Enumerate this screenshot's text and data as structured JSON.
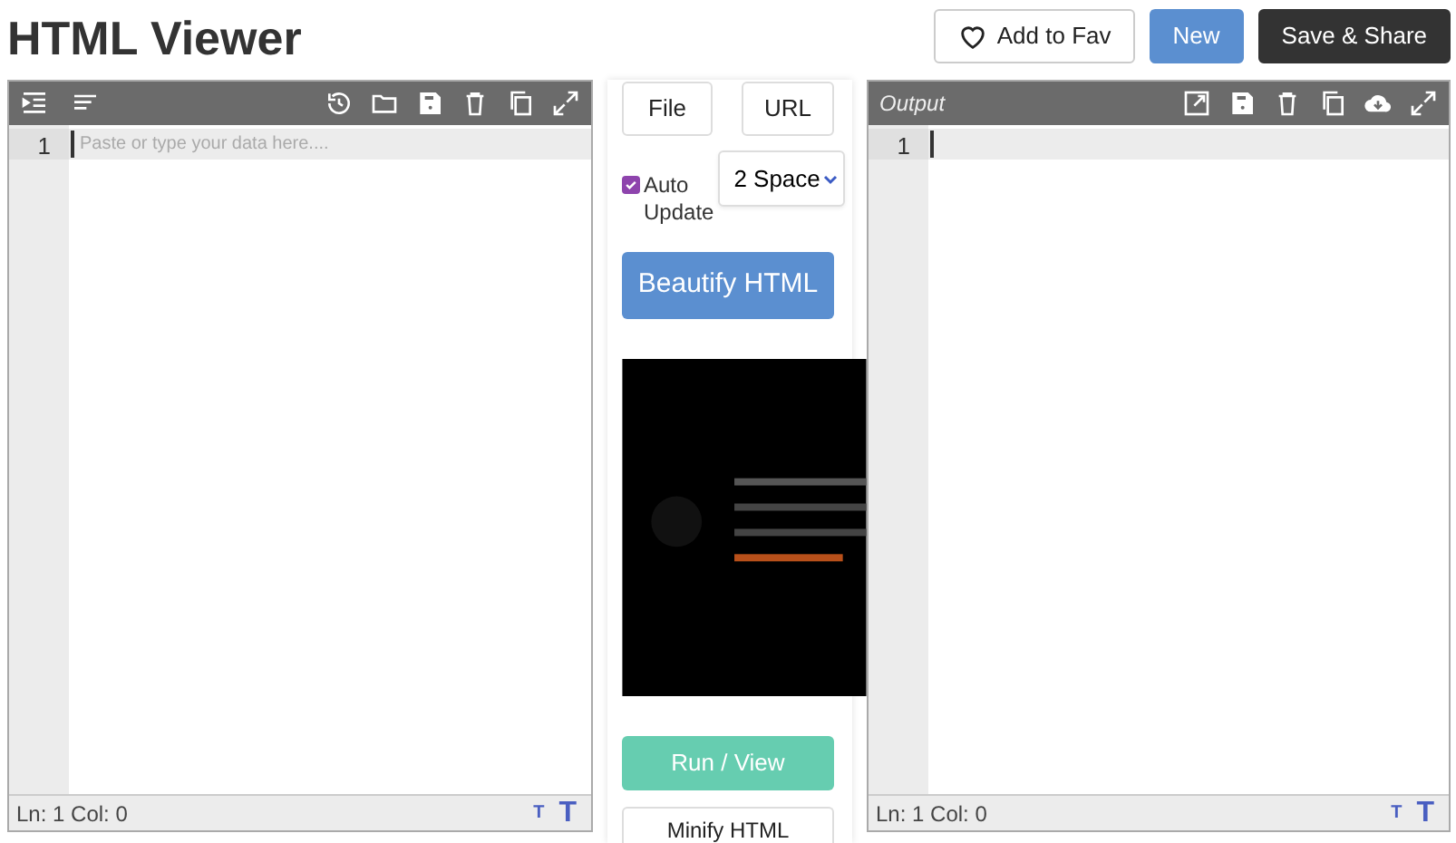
{
  "title": "HTML Viewer",
  "header_buttons": [
    {
      "label": "Add to Fav",
      "kind": "fav"
    },
    {
      "label": "New",
      "kind": "primary"
    },
    {
      "label": "Save & Share",
      "kind": "dark"
    }
  ],
  "input_editor": {
    "line_numbers": [
      "1"
    ],
    "placeholder": "Paste or type your data here....",
    "status": "Ln: 1 Col: 0",
    "font_buttons": [
      "T",
      "T"
    ]
  },
  "controls": {
    "file_button": "File",
    "url_button": "URL",
    "auto_update": {
      "label": "Auto Update",
      "checked": true
    },
    "indent_select": {
      "value": "2 Space"
    },
    "beautify_button": "Beautify HTML",
    "run_button": "Run / View",
    "minify_button": "Minify HTML"
  },
  "output_editor": {
    "title": "Output",
    "line_numbers": [
      "1"
    ],
    "status": "Ln: 1 Col: 0",
    "font_buttons": [
      "T",
      "T"
    ]
  }
}
